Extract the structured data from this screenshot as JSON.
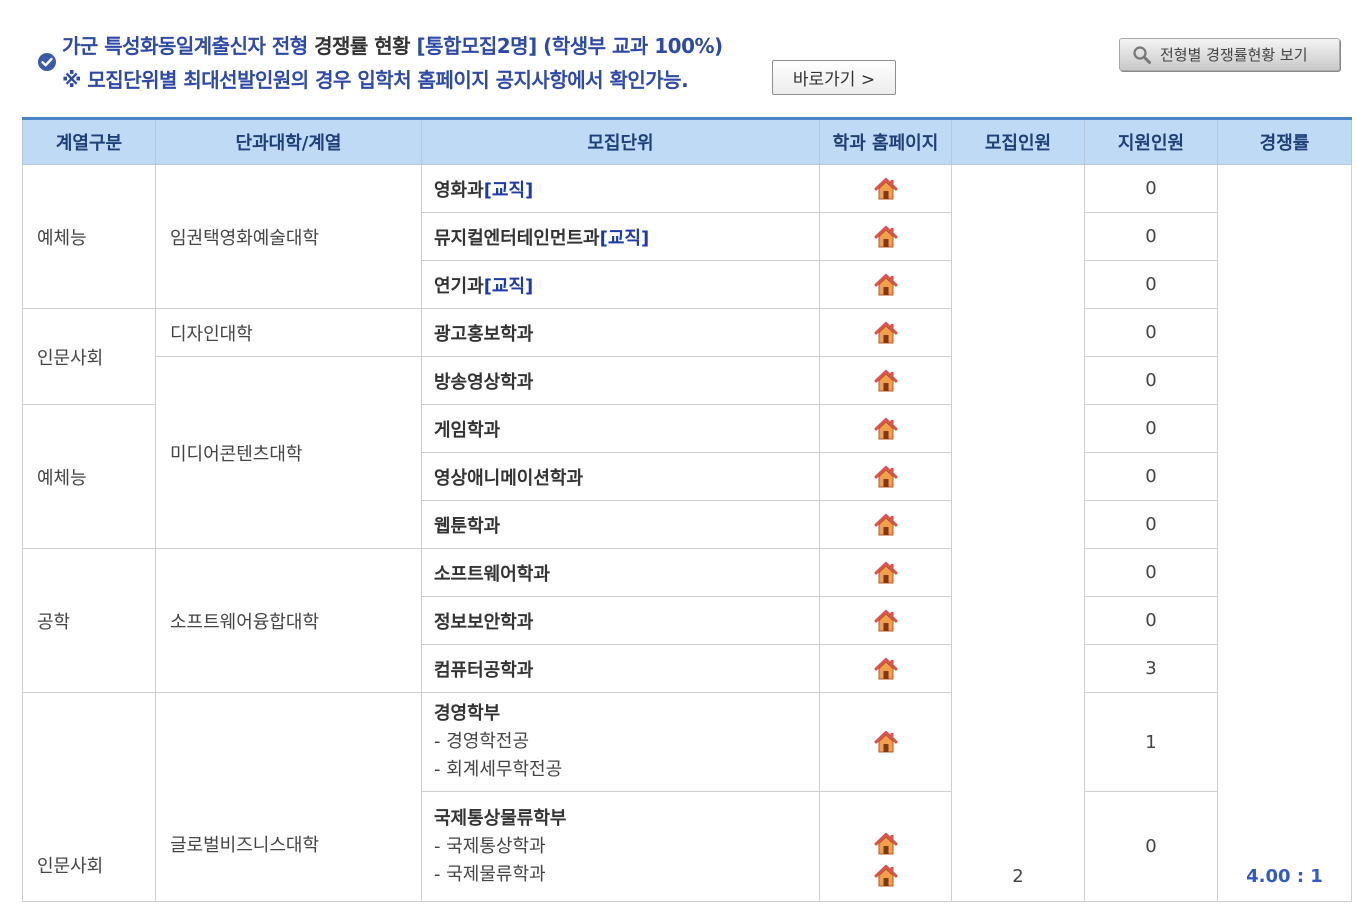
{
  "header": {
    "title_part1": "가군 특성화동일계출신자 전형 ",
    "title_part2": "경쟁률 현황",
    "title_part3": " [통합모집2명] (학생부 교과 100%)",
    "notice": "※ 모집단위별 최대선발인원의 경우 입학처 홈페이지 공지사항에서 확인가능.",
    "go_button": "바로가기 >",
    "view_button": "전형별 경쟁률현황 보기"
  },
  "table": {
    "columns": [
      "계열구분",
      "단과대학/계열",
      "모집단위",
      "학과 홈페이지",
      "모집인원",
      "지원인원",
      "경쟁률"
    ],
    "rows": [
      {
        "category": "예체능",
        "college": "임권택영화예술대학",
        "unit": "영화과",
        "tag": "[교직]",
        "applicants": "0"
      },
      {
        "unit": "뮤지컬엔터테인먼트과",
        "tag": "[교직]",
        "applicants": "0"
      },
      {
        "unit": "연기과",
        "tag": "[교직]",
        "applicants": "0"
      },
      {
        "category": "인문사회",
        "college": "디자인대학",
        "unit": "광고홍보학과",
        "applicants": "0"
      },
      {
        "college": "미디어콘텐츠대학",
        "unit": "방송영상학과",
        "applicants": "0"
      },
      {
        "category": "예체능",
        "unit": "게임학과",
        "applicants": "0"
      },
      {
        "unit": "영상애니메이션학과",
        "applicants": "0"
      },
      {
        "unit": "웹툰학과",
        "applicants": "0"
      },
      {
        "category": "공학",
        "college": "소프트웨어융합대학",
        "unit": "소프트웨어학과",
        "applicants": "0"
      },
      {
        "unit": "정보보안학과",
        "applicants": "0"
      },
      {
        "unit": "컴퓨터공학과",
        "applicants": "3"
      },
      {
        "category": "인문사회",
        "college": "글로벌비즈니스대학",
        "unit": "경영학부",
        "subs": [
          "- 경영학전공",
          "- 회계세무학전공"
        ],
        "applicants": "1"
      },
      {
        "unit": "국제통상물류학부",
        "subs": [
          "- 국제통상학과",
          "- 국제물류학과"
        ],
        "applicants": "0"
      }
    ],
    "quota": "2",
    "rate": "4.00 : 1"
  },
  "colors": {
    "accent": "#2e4aa6",
    "header_bg": "#bfdaf4",
    "home_icon": "#d9534f"
  }
}
